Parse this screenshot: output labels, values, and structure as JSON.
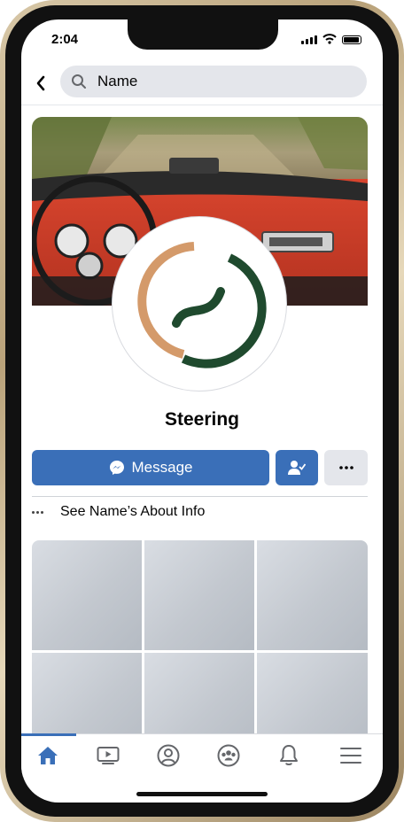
{
  "status_bar": {
    "time": "2:04"
  },
  "search": {
    "value": "Name"
  },
  "profile": {
    "name": "Steering"
  },
  "actions": {
    "message_label": "Message"
  },
  "about": {
    "label": "See Name’s About Info"
  },
  "photos": {
    "tile_count": 6
  },
  "tabs": [
    {
      "icon": "home-icon",
      "active": true
    },
    {
      "icon": "video-icon",
      "active": false
    },
    {
      "icon": "profile-icon",
      "active": false
    },
    {
      "icon": "groups-icon",
      "active": false
    },
    {
      "icon": "bell-icon",
      "active": false
    },
    {
      "icon": "menu-icon",
      "active": false
    }
  ],
  "colors": {
    "accent": "#3a6fb8",
    "logo_orange": "#d49a6a",
    "logo_green": "#1f4a2e"
  }
}
